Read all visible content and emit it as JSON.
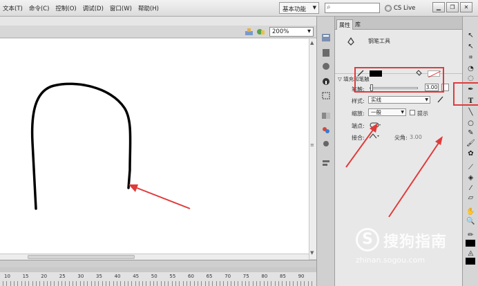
{
  "menubar": {
    "items": [
      "文本(T)",
      "命令(C)",
      "控制(O)",
      "调试(D)",
      "窗口(W)",
      "帮助(H)"
    ],
    "workspace_label": "基本功能",
    "search_placeholder": "",
    "cs_live_label": "CS Live"
  },
  "stage": {
    "zoom_value": "200%",
    "drawing_stroke_color": "#000000"
  },
  "timeline": {
    "ruler_numbers": [
      "10",
      "15",
      "20",
      "25",
      "30",
      "35",
      "40",
      "45",
      "50",
      "55",
      "60",
      "65",
      "70",
      "75",
      "80",
      "85",
      "90"
    ]
  },
  "panel": {
    "tabs": [
      "属性",
      "库"
    ],
    "tool_name": "钢笔工具",
    "section_title": "填充和笔触",
    "stroke_width_label": "笔触:",
    "stroke_width_value": "3.00",
    "style_label": "样式:",
    "style_value": "实线",
    "scale_label": "缩放:",
    "scale_value": "一般",
    "hint_label": "提示",
    "cap_label": "端点:",
    "join_label": "接合:",
    "miter_label": "尖角:",
    "miter_value": "3.00"
  },
  "colors": {
    "annotation_red": "#e03a3a",
    "stroke_swatch": "#000000"
  },
  "watermark": {
    "logo_glyph": "S",
    "brand": "搜狗指南",
    "url": "zhinan.sogou.com"
  }
}
